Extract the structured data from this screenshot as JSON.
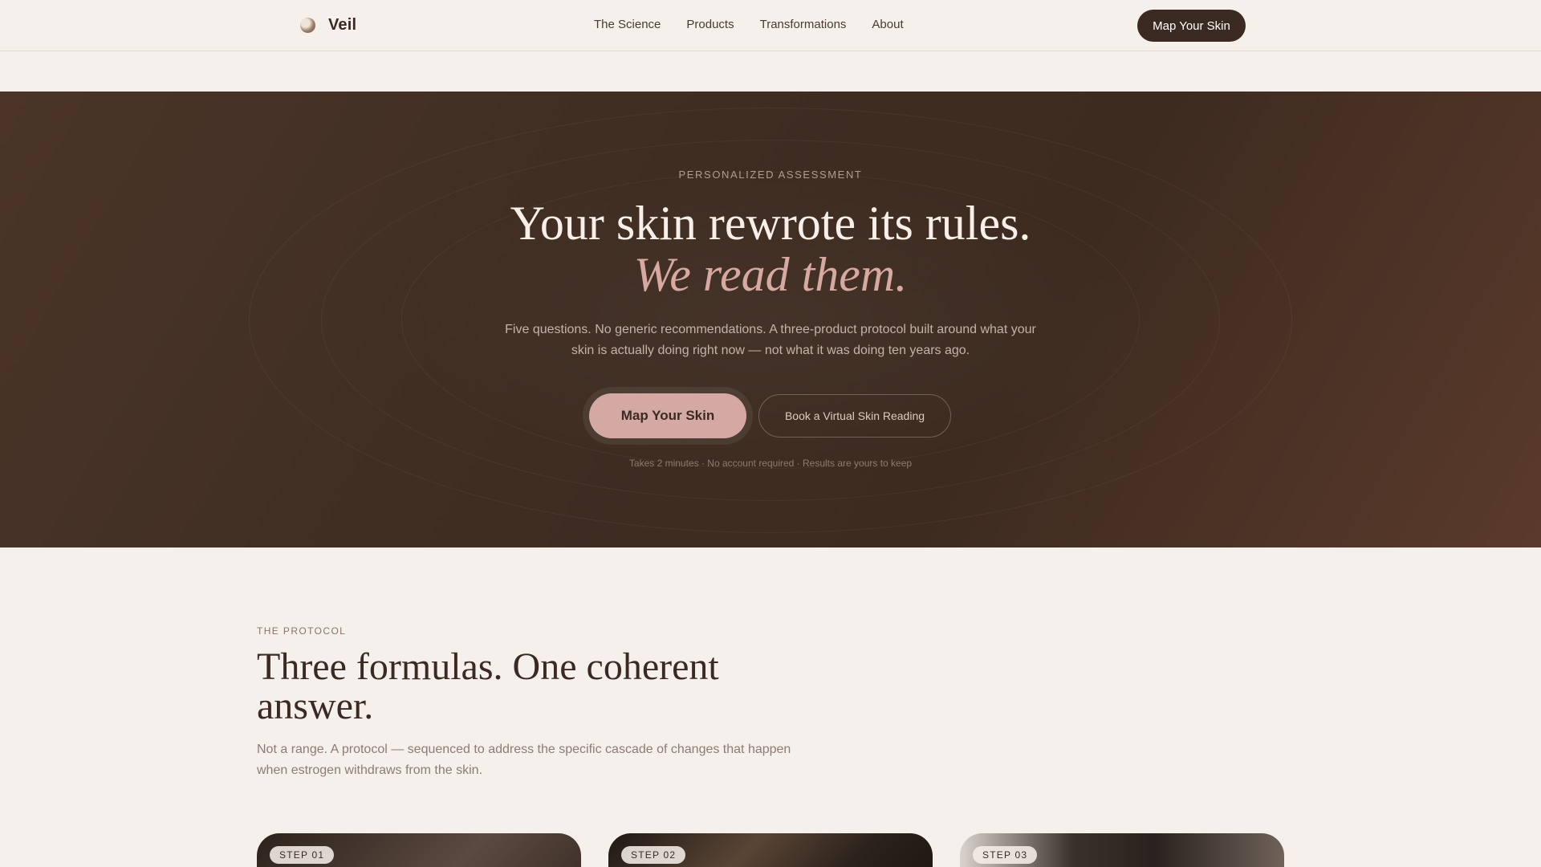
{
  "nav": {
    "brand": "Veil",
    "links": [
      "The Science",
      "Products",
      "Transformations",
      "About"
    ],
    "cta": "Map Your Skin"
  },
  "hero": {
    "eyebrow": "PERSONALIZED ASSESSMENT",
    "title": "Your skin rewrote its rules.",
    "title_em": "We read them.",
    "subtitle": "Five questions. No generic recommendations. A three-product protocol built around what your skin is actually doing right now — not what it was doing ten years ago.",
    "primary_cta": "Map Your Skin",
    "secondary_cta": "Book a Virtual Skin Reading",
    "note": "Takes 2 minutes · No account required · Results are yours to keep"
  },
  "protocol": {
    "eyebrow": "THE PROTOCOL",
    "title": "Three formulas. One coherent answer.",
    "subtitle": "Not a range. A protocol — sequenced to address the specific cascade of changes that happen when estrogen withdraws from the skin.",
    "steps": [
      "STEP 01",
      "STEP 02",
      "STEP 03"
    ]
  },
  "colors": {
    "brand_dark": "#3b2a22",
    "accent_rose": "#d4a9a3",
    "page_bg": "#f5f0ec"
  },
  "icons": {
    "brand_mark": "globe-mark-icon"
  }
}
